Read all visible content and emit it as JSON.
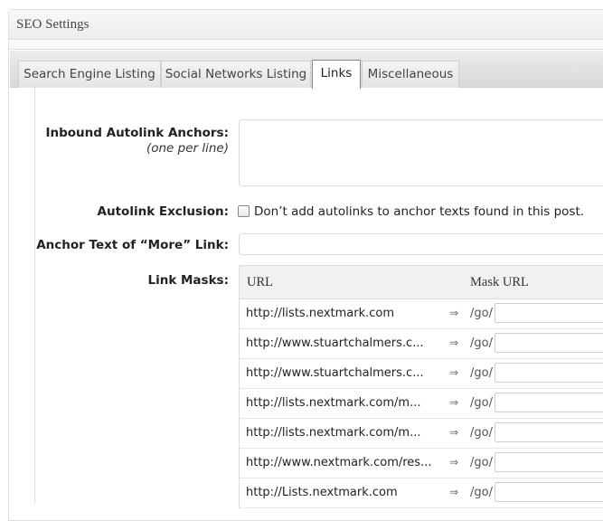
{
  "panel": {
    "title": "SEO Settings"
  },
  "tabs": [
    {
      "label": "Search Engine Listing"
    },
    {
      "label": "Social Networks Listing"
    },
    {
      "label": "Links",
      "active": true
    },
    {
      "label": "Miscellaneous"
    }
  ],
  "form": {
    "inbound_label": "Inbound Autolink Anchors:",
    "inbound_hint": "(one per line)",
    "inbound_value": "",
    "exclusion_label": "Autolink Exclusion:",
    "exclusion_checkbox_label": "Don’t add autolinks to anchor texts found in this post.",
    "exclusion_checked": false,
    "more_link_label": "Anchor Text of “More” Link:",
    "more_link_value": "",
    "link_masks_label": "Link Masks:"
  },
  "link_masks": {
    "col_url": "URL",
    "col_mask": "Mask URL",
    "arrow": "⇒",
    "prefix": "/go/",
    "rows": [
      {
        "url": "http://lists.nextmark.com",
        "mask": ""
      },
      {
        "url": "http://www.stuartchalmers.c...",
        "mask": ""
      },
      {
        "url": "http://www.stuartchalmers.c...",
        "mask": ""
      },
      {
        "url": "http://lists.nextmark.com/m...",
        "mask": ""
      },
      {
        "url": "http://lists.nextmark.com/m...",
        "mask": ""
      },
      {
        "url": "http://www.nextmark.com/res...",
        "mask": ""
      },
      {
        "url": "http://Lists.nextmark.com",
        "mask": ""
      }
    ]
  }
}
